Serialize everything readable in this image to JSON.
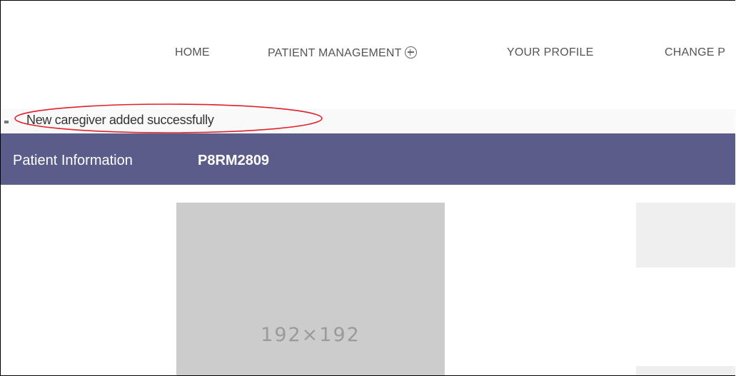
{
  "nav": {
    "home": "HOME",
    "patient_management": "PATIENT MANAGEMENT",
    "your_profile": "YOUR PROFILE",
    "change": "CHANGE P"
  },
  "alert": {
    "message": "New caregiver added successfully",
    "highlight_color": "#e0202a"
  },
  "patient": {
    "title": "Patient Information",
    "id": "P8RM2809",
    "bar_color": "#5a5c89"
  },
  "image_placeholder": {
    "label": "192×192"
  },
  "icons": {
    "patient_management_expand": "plus-circle-icon"
  }
}
